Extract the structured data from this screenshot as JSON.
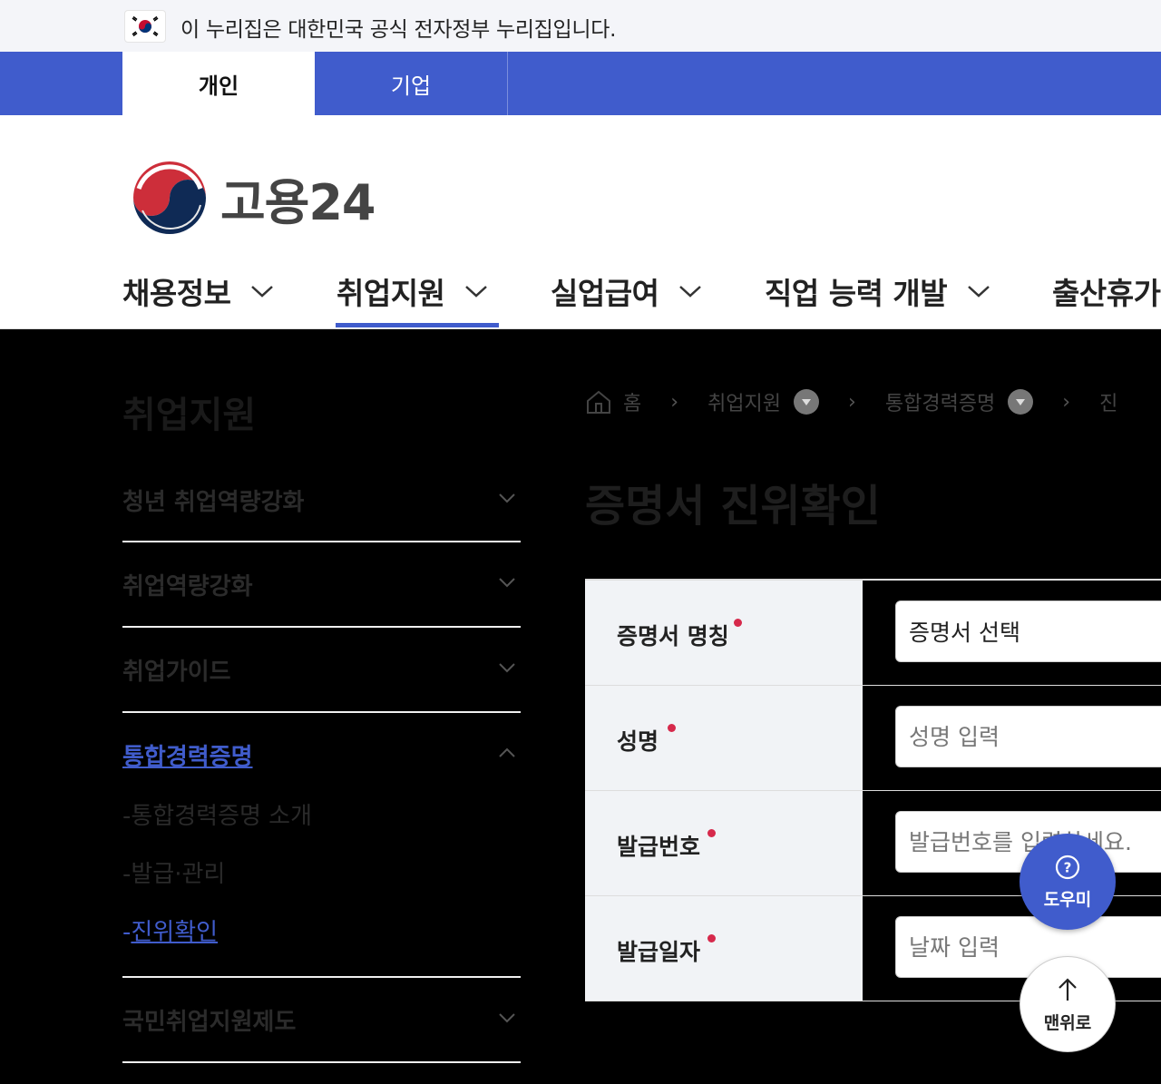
{
  "gov_banner": {
    "text": "이 누리집은 대한민국 공식 전자정부 누리집입니다."
  },
  "audience_tabs": {
    "personal": "개인",
    "corporate": "기업"
  },
  "logo": {
    "text": "고용24"
  },
  "gnb": [
    {
      "label": "채용정보"
    },
    {
      "label": "취업지원"
    },
    {
      "label": "실업급여"
    },
    {
      "label": "직업 능력 개발"
    },
    {
      "label": "출산휴가"
    }
  ],
  "lnb": {
    "title": "취업지원",
    "items": [
      {
        "label": "청년 취업역량강화"
      },
      {
        "label": "취업역량강화"
      },
      {
        "label": "취업가이드"
      },
      {
        "label": "통합경력증명"
      },
      {
        "label": "국민취업지원제도"
      }
    ],
    "sub_items": [
      {
        "label": "통합경력증명 소개"
      },
      {
        "label": "발급·관리"
      },
      {
        "label": "진위확인"
      }
    ],
    "sub_prefix": "-"
  },
  "breadcrumb": {
    "home": "홈",
    "level1": "취업지원",
    "level2": "통합경력증명",
    "level3": "진"
  },
  "page_title": "증명서 진위확인",
  "form": {
    "fields": [
      {
        "label": "증명서 명칭",
        "value": "증명서 선택",
        "placeholder": ""
      },
      {
        "label": "성명",
        "value": "",
        "placeholder": "성명 입력"
      },
      {
        "label": "발급번호",
        "value": "",
        "placeholder": "발급번호를 입력하세요."
      },
      {
        "label": "발급일자",
        "value": "",
        "placeholder": "날짜 입력"
      }
    ]
  },
  "floating": {
    "help": "도우미",
    "top": "맨위로"
  },
  "colors": {
    "brand": "#405ccc",
    "required": "#d6294b"
  }
}
